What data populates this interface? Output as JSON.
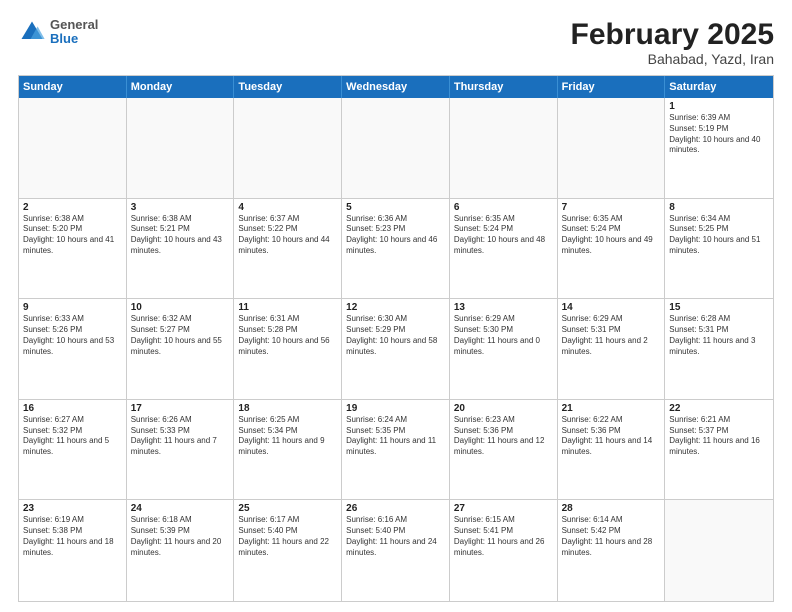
{
  "header": {
    "logo": {
      "general": "General",
      "blue": "Blue"
    },
    "title": "February 2025",
    "subtitle": "Bahabad, Yazd, Iran"
  },
  "weekdays": [
    "Sunday",
    "Monday",
    "Tuesday",
    "Wednesday",
    "Thursday",
    "Friday",
    "Saturday"
  ],
  "weeks": [
    [
      {
        "day": "",
        "empty": true
      },
      {
        "day": "",
        "empty": true
      },
      {
        "day": "",
        "empty": true
      },
      {
        "day": "",
        "empty": true
      },
      {
        "day": "",
        "empty": true
      },
      {
        "day": "",
        "empty": true
      },
      {
        "day": "1",
        "sunrise": "6:39 AM",
        "sunset": "5:19 PM",
        "daylight": "10 hours and 40 minutes."
      }
    ],
    [
      {
        "day": "2",
        "sunrise": "6:38 AM",
        "sunset": "5:20 PM",
        "daylight": "10 hours and 41 minutes."
      },
      {
        "day": "3",
        "sunrise": "6:38 AM",
        "sunset": "5:21 PM",
        "daylight": "10 hours and 43 minutes."
      },
      {
        "day": "4",
        "sunrise": "6:37 AM",
        "sunset": "5:22 PM",
        "daylight": "10 hours and 44 minutes."
      },
      {
        "day": "5",
        "sunrise": "6:36 AM",
        "sunset": "5:23 PM",
        "daylight": "10 hours and 46 minutes."
      },
      {
        "day": "6",
        "sunrise": "6:35 AM",
        "sunset": "5:24 PM",
        "daylight": "10 hours and 48 minutes."
      },
      {
        "day": "7",
        "sunrise": "6:35 AM",
        "sunset": "5:24 PM",
        "daylight": "10 hours and 49 minutes."
      },
      {
        "day": "8",
        "sunrise": "6:34 AM",
        "sunset": "5:25 PM",
        "daylight": "10 hours and 51 minutes."
      }
    ],
    [
      {
        "day": "9",
        "sunrise": "6:33 AM",
        "sunset": "5:26 PM",
        "daylight": "10 hours and 53 minutes."
      },
      {
        "day": "10",
        "sunrise": "6:32 AM",
        "sunset": "5:27 PM",
        "daylight": "10 hours and 55 minutes."
      },
      {
        "day": "11",
        "sunrise": "6:31 AM",
        "sunset": "5:28 PM",
        "daylight": "10 hours and 56 minutes."
      },
      {
        "day": "12",
        "sunrise": "6:30 AM",
        "sunset": "5:29 PM",
        "daylight": "10 hours and 58 minutes."
      },
      {
        "day": "13",
        "sunrise": "6:29 AM",
        "sunset": "5:30 PM",
        "daylight": "11 hours and 0 minutes."
      },
      {
        "day": "14",
        "sunrise": "6:29 AM",
        "sunset": "5:31 PM",
        "daylight": "11 hours and 2 minutes."
      },
      {
        "day": "15",
        "sunrise": "6:28 AM",
        "sunset": "5:31 PM",
        "daylight": "11 hours and 3 minutes."
      }
    ],
    [
      {
        "day": "16",
        "sunrise": "6:27 AM",
        "sunset": "5:32 PM",
        "daylight": "11 hours and 5 minutes."
      },
      {
        "day": "17",
        "sunrise": "6:26 AM",
        "sunset": "5:33 PM",
        "daylight": "11 hours and 7 minutes."
      },
      {
        "day": "18",
        "sunrise": "6:25 AM",
        "sunset": "5:34 PM",
        "daylight": "11 hours and 9 minutes."
      },
      {
        "day": "19",
        "sunrise": "6:24 AM",
        "sunset": "5:35 PM",
        "daylight": "11 hours and 11 minutes."
      },
      {
        "day": "20",
        "sunrise": "6:23 AM",
        "sunset": "5:36 PM",
        "daylight": "11 hours and 12 minutes."
      },
      {
        "day": "21",
        "sunrise": "6:22 AM",
        "sunset": "5:36 PM",
        "daylight": "11 hours and 14 minutes."
      },
      {
        "day": "22",
        "sunrise": "6:21 AM",
        "sunset": "5:37 PM",
        "daylight": "11 hours and 16 minutes."
      }
    ],
    [
      {
        "day": "23",
        "sunrise": "6:19 AM",
        "sunset": "5:38 PM",
        "daylight": "11 hours and 18 minutes."
      },
      {
        "day": "24",
        "sunrise": "6:18 AM",
        "sunset": "5:39 PM",
        "daylight": "11 hours and 20 minutes."
      },
      {
        "day": "25",
        "sunrise": "6:17 AM",
        "sunset": "5:40 PM",
        "daylight": "11 hours and 22 minutes."
      },
      {
        "day": "26",
        "sunrise": "6:16 AM",
        "sunset": "5:40 PM",
        "daylight": "11 hours and 24 minutes."
      },
      {
        "day": "27",
        "sunrise": "6:15 AM",
        "sunset": "5:41 PM",
        "daylight": "11 hours and 26 minutes."
      },
      {
        "day": "28",
        "sunrise": "6:14 AM",
        "sunset": "5:42 PM",
        "daylight": "11 hours and 28 minutes."
      },
      {
        "day": "",
        "empty": true
      }
    ]
  ]
}
